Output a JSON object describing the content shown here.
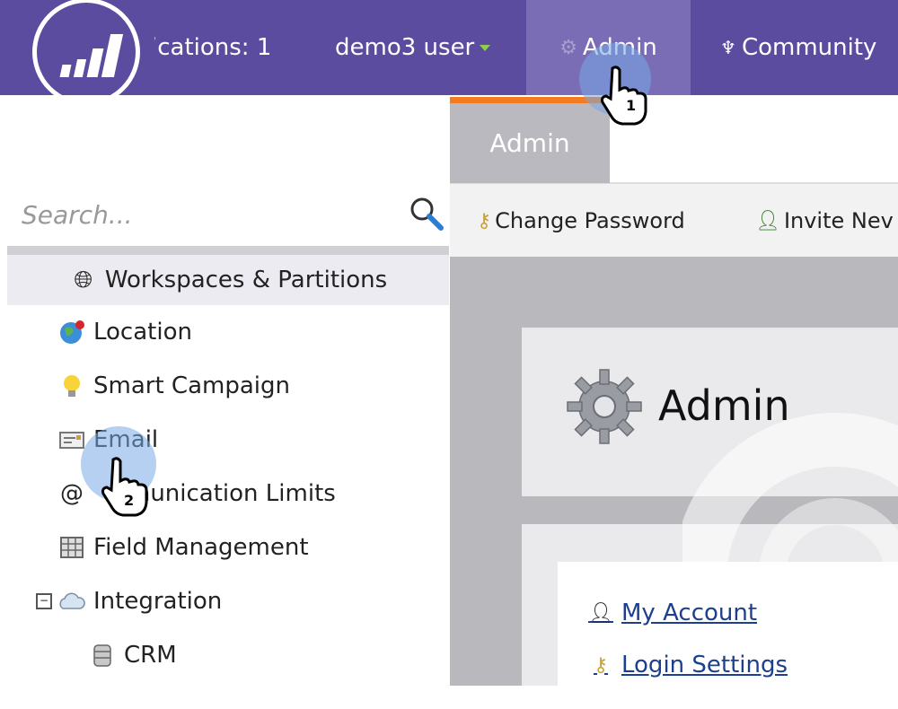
{
  "topnav": {
    "notifications": "ications: 1",
    "user": "demo3 user",
    "admin": "Admin",
    "community": "Community"
  },
  "search": {
    "placeholder": "Search..."
  },
  "sidebar": {
    "items": [
      {
        "label": "Workspaces & Partitions",
        "icon": "globe-icon"
      },
      {
        "label": "Location",
        "icon": "earth-icon"
      },
      {
        "label": "Smart Campaign",
        "icon": "lightbulb-icon"
      },
      {
        "label": "Email",
        "icon": "email-icon"
      },
      {
        "label": "munication Limits",
        "icon": "at-icon"
      },
      {
        "label": "Field Management",
        "icon": "grid-icon"
      },
      {
        "label": "Integration",
        "icon": "cloud-icon"
      },
      {
        "label": "CRM",
        "icon": "database-icon"
      }
    ]
  },
  "tabs": {
    "active": "Admin"
  },
  "toolbar": {
    "change_password": "Change Password",
    "invite_new": "Invite Nev"
  },
  "main": {
    "title": "Admin",
    "links": [
      {
        "label": "My Account",
        "icon": "user-icon"
      },
      {
        "label": "Login Settings",
        "icon": "key-icon"
      }
    ]
  },
  "callouts": {
    "step1": "1",
    "step2": "2"
  },
  "colors": {
    "nav_bg": "#5c4c9f",
    "nav_active": "#7b6db5",
    "tab_accent": "#f47b20",
    "link": "#1d3f8f"
  }
}
